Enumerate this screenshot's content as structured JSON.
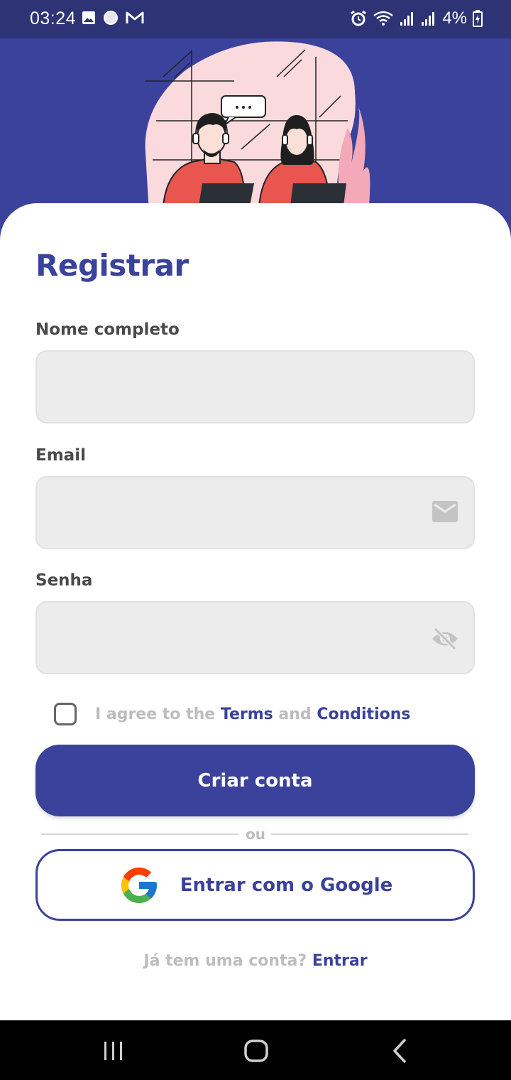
{
  "status_bar": {
    "time": "03:24",
    "battery": "4%",
    "left_icons": [
      "image-icon",
      "circle-icon",
      "gmail-icon"
    ],
    "right_icons": [
      "alarm-icon",
      "wifi-icon",
      "signal-icon",
      "signal-icon",
      "battery-charging-icon"
    ]
  },
  "form": {
    "title": "Registrar",
    "name_label": "Nome completo",
    "name_value": "",
    "email_label": "Email",
    "email_value": "",
    "password_label": "Senha",
    "password_value": ""
  },
  "terms": {
    "checked": false,
    "prefix": "I agree to the",
    "terms_link": "Terms",
    "and": "and",
    "conditions_link": "Conditions"
  },
  "buttons": {
    "create_account": "Criar conta",
    "divider_text": "ou",
    "google": "Entrar com o Google"
  },
  "footer": {
    "question": "Já tem uma conta?",
    "login_link": "Entrar"
  },
  "colors": {
    "primary": "#3a429b",
    "status_bar": "#2d3375",
    "field_bg": "#ececec",
    "muted_text": "#bdbdbd"
  }
}
